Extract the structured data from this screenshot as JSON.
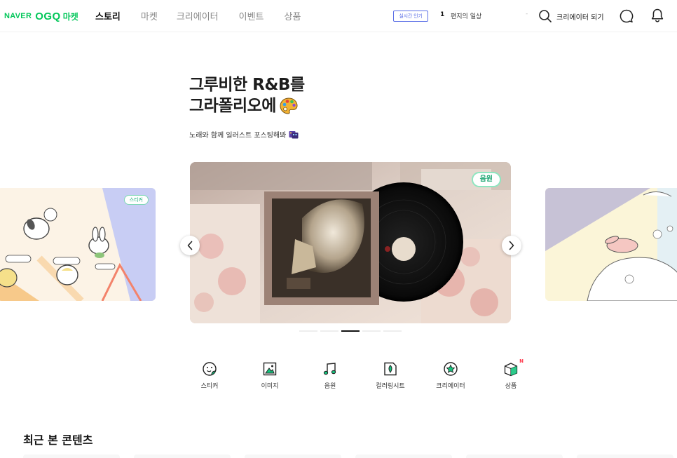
{
  "header": {
    "logo": {
      "naver": "NAVER",
      "ogq": "OGQ",
      "market": "마켓"
    },
    "nav": [
      "스토리",
      "마켓",
      "크리에이터",
      "이벤트",
      "상품"
    ],
    "realtime": {
      "badge": "실시간 인기",
      "rank": "1",
      "keyword": "편지의 일상"
    },
    "dash": "-",
    "creator_link": "크리에이터 되기"
  },
  "hero": {
    "title_line1": "그루비한 R&B를",
    "title_line2": "그라폴리오에",
    "subtitle": "노래와 함께 일러스트 포스팅해봐"
  },
  "carousel": {
    "left_badge": "스티커",
    "main_badge": "음원",
    "active_dot": 2,
    "dot_count": 6
  },
  "categories": [
    {
      "label": "스티커",
      "icon": "sticker-icon"
    },
    {
      "label": "이미지",
      "icon": "image-icon"
    },
    {
      "label": "음원",
      "icon": "music-icon"
    },
    {
      "label": "컬러링시트",
      "icon": "coloring-sheet-icon"
    },
    {
      "label": "크리에이터",
      "icon": "creator-icon"
    },
    {
      "label": "상품",
      "icon": "product-icon",
      "badge": "N"
    }
  ],
  "recent": {
    "title": "최근 본 콘텐츠"
  },
  "colors": {
    "brand": "#03c75a",
    "accent_blue": "#5a6ee6",
    "green_badge": "#1ea774",
    "new_red": "#ff3b4e"
  }
}
